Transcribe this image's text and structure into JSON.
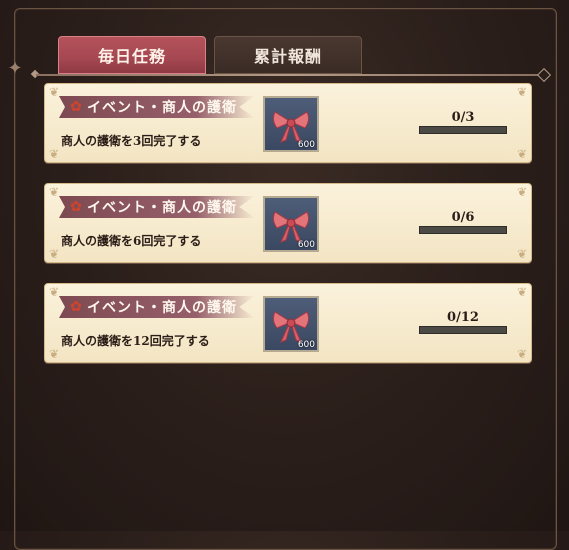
{
  "tabs": {
    "daily": "毎日任務",
    "cumulative": "累計報酬"
  },
  "missions": [
    {
      "event_title": "イベント・商人の護衛",
      "description": "商人の護衛を3回完了する",
      "reward_count": "600",
      "progress_text": "0/3",
      "progress_fraction": 0
    },
    {
      "event_title": "イベント・商人の護衛",
      "description": "商人の護衛を6回完了する",
      "reward_count": "600",
      "progress_text": "0/6",
      "progress_fraction": 0
    },
    {
      "event_title": "イベント・商人の護衛",
      "description": "商人の護衛を12回完了する",
      "reward_count": "600",
      "progress_text": "0/12",
      "progress_fraction": 0
    }
  ],
  "icons": {
    "reward_item": "ribbon-bow-icon",
    "event_marker": "flower-icon"
  },
  "colors": {
    "active_tab": "#a54852",
    "inactive_tab": "#3a2b25",
    "card_bg": "#f3e5c3",
    "ribbon": "#96606a"
  }
}
